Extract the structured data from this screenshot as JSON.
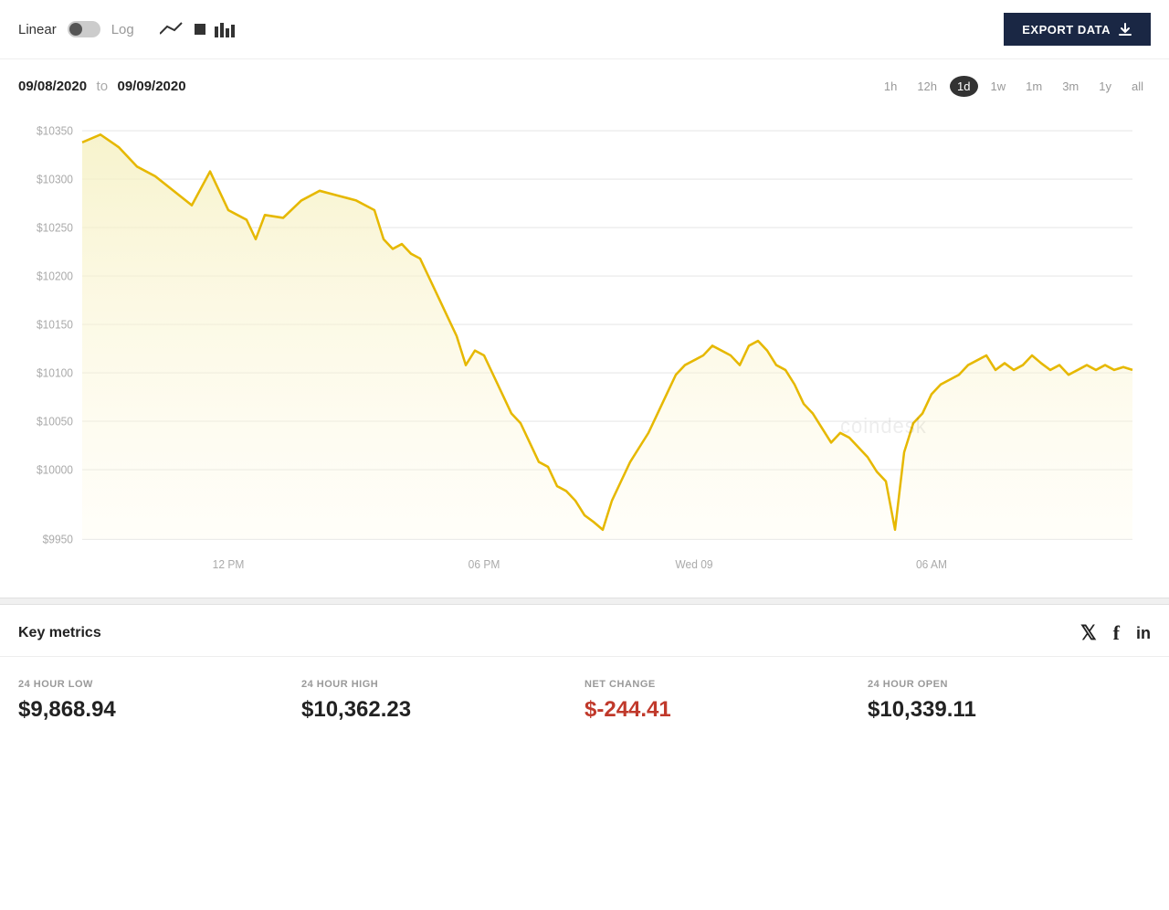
{
  "header": {
    "linear_label": "Linear",
    "log_label": "Log",
    "export_button": "EXPORT DATA"
  },
  "chart": {
    "date_range_from": "09/08/2020",
    "date_range_to": "to",
    "date_range_end": "09/09/2020",
    "watermark": "coindesk",
    "time_filters": [
      "1h",
      "12h",
      "1d",
      "1w",
      "1m",
      "3m",
      "1y",
      "all"
    ],
    "active_filter": "1d",
    "y_axis_labels": [
      "$10350",
      "$10300",
      "$10250",
      "$10200",
      "$10150",
      "$10100",
      "$10050",
      "$10000",
      "$9950"
    ],
    "x_axis_labels": [
      "12 PM",
      "06 PM",
      "Wed 09",
      "06 AM"
    ]
  },
  "metrics": {
    "title": "Key metrics",
    "items": [
      {
        "label": "24 HOUR LOW",
        "value": "$9,868.94"
      },
      {
        "label": "24 HOUR HIGH",
        "value": "$10,362.23"
      },
      {
        "label": "NET CHANGE",
        "value": "$-244.41",
        "negative": true
      },
      {
        "label": "24 HOUR OPEN",
        "value": "$10,339.11"
      }
    ]
  },
  "social": {
    "twitter": "𝕏",
    "facebook": "f",
    "linkedin": "in"
  }
}
